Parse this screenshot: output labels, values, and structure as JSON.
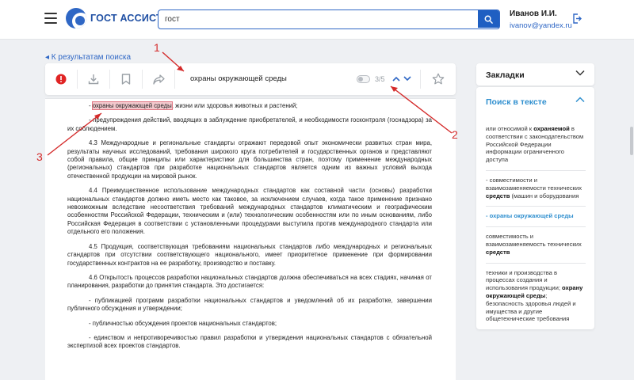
{
  "header": {
    "logo_text": "ГОСТ АССИСТЕНТ",
    "search_value": "гост",
    "user_name": "Иванов И.И.",
    "user_email": "ivanov@yandex.ru"
  },
  "back_link": "◂ К результатам поиска",
  "toolbar": {
    "query": "охраны окружающей среды",
    "counter": "3/5"
  },
  "document": {
    "p1_prefix": "- ",
    "p1_highlight": "охраны окружающей среды",
    "p1_suffix": ", жизни или здоровья животных и растений;",
    "p2": "- предупреждения действий, вводящих в заблуждение приобретателей, и необходимости госконтроля (госнадзора) за их соблюдением.",
    "p3": "4.3 Международные и региональные стандарты отражают передовой опыт экономически развитых стран мира, результаты научных исследований, требования широкого круга потребителей и государственных органов и представляют собой правила, общие принципы или характеристики для большинства стран, поэтому применение международных (региональных) стандартов при разработке национальных стандартов является одним из важных условий выхода отечественной продукции на мировой рынок.",
    "p4": "4.4 Преимущественное использование международных стандартов как составной части (основы) разработки национальных стандартов должно иметь место как таковое, за исключением случаев, когда такое применение признано невозможным вследствие несоответствия требований международных стандартов климатическим и географическим особенностям Российской Федерации, техническим и (или) технологическим особенностям или по иным основаниям, либо Российская Федерация в соответствии с установленными процедурами выступила против международного стандарта или отдельного его положения.",
    "p5": "4.5 Продукция, соответствующая требованиям национальных стандартов либо международных и региональных стандартов при отсутствии соответствующего национального, имеет приоритетное применение при формировании государственных контрактов на ее разработку, производство и поставку.",
    "p6": "4.6 Открытость процессов разработки национальных стандартов должна обеспечиваться на всех стадиях, начиная от планирования, разработки до принятия стандарта. Это достигается:",
    "p7": "- публикацией программ разработки национальных стандартов и уведомлений об их разработке, завершении публичного обсуждения и утверждении;",
    "p8": "- публичностью обсуждения проектов национальных стандартов;",
    "p9": "- единством и непротиворечивостью правил разработки и утверждения национальных стандартов с обязательной экспертизой всех проектов стандартов."
  },
  "sidebar": {
    "bookmarks_title": "Закладки",
    "search_title": "Поиск в тексте",
    "results": [
      {
        "before": "или относимой к ",
        "bold": "охраняемой",
        "after": " в соответствии с законодательством Российской Федерации информации ограниченного доступа"
      },
      {
        "before": "- совместимости и взаимозаменяемости технических ",
        "bold": "средств",
        "after": " (машин и оборудования"
      },
      {
        "before": "- охраны окружающей среды",
        "bold": "",
        "after": ""
      },
      {
        "before": "совместимость и взаимозаменяемость технических ",
        "bold": "средств",
        "after": ""
      },
      {
        "before": "техники и производства в процессах создания и использования продукции; ",
        "bold": "охрану окружающей среды",
        "after": "; безопасность здоровья людей и имущества и другие общетехнические требования"
      }
    ]
  },
  "annotations": {
    "n1": "1",
    "n2": "2",
    "n3": "3"
  },
  "colors": {
    "accent": "#2f67c5",
    "link": "#2f8fcf",
    "annotation": "#d42a2a",
    "highlight": "#f3c8cd",
    "alert": "#e02424"
  }
}
